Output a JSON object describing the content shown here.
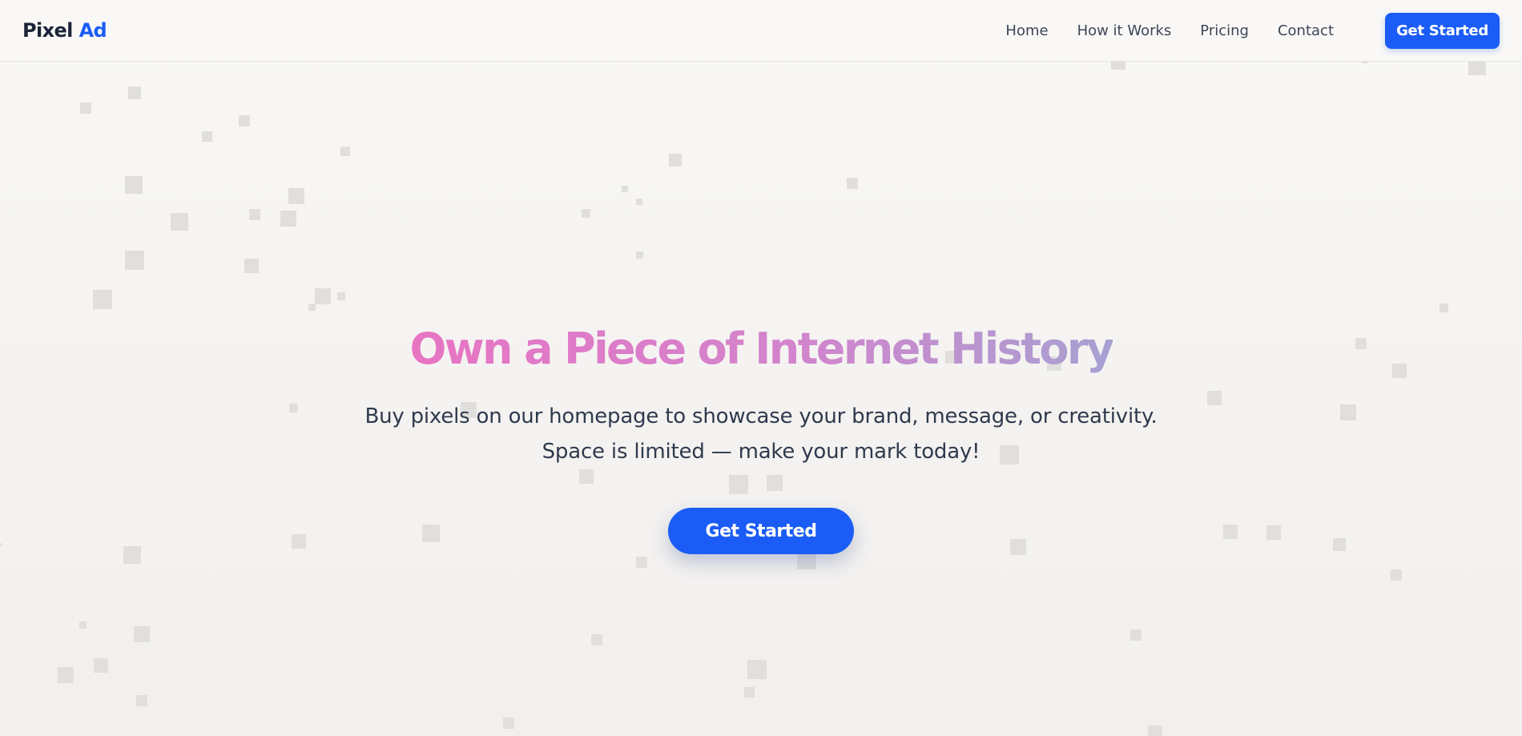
{
  "nav": {
    "logo_main": "Pixel",
    "logo_accent": "Ad",
    "links": [
      "Home",
      "How it Works",
      "Pricing",
      "Contact"
    ],
    "cta_label": "Get Started"
  },
  "hero": {
    "title": "Own a Piece of Internet History",
    "subtitle_line1": "Buy pixels on our homepage to showcase your brand, message, or creativity.",
    "subtitle_line2": "Space is limited — make your mark today!",
    "cta_label": "Get Started"
  },
  "colors": {
    "brand": "#1a5cf5",
    "title_gradient_start": "#e874c4",
    "title_gradient_end": "#a7a1d2",
    "pixel": "#e0dfdd"
  }
}
